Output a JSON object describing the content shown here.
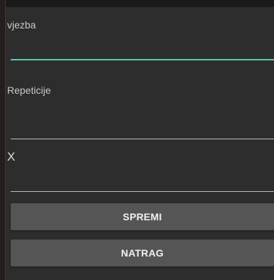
{
  "form": {
    "exercise": {
      "label": "vjezba",
      "value": ""
    },
    "repetitions": {
      "label": "Repeticije",
      "value": ""
    },
    "multiplier": {
      "label": "X",
      "value": ""
    }
  },
  "actions": {
    "save_label": "SPREMI",
    "back_label": "NATRAG"
  },
  "colors": {
    "background": "#2d2d2d",
    "accent_focus": "#58c9b0",
    "button": "#555555",
    "underline": "#bdbdbd"
  }
}
